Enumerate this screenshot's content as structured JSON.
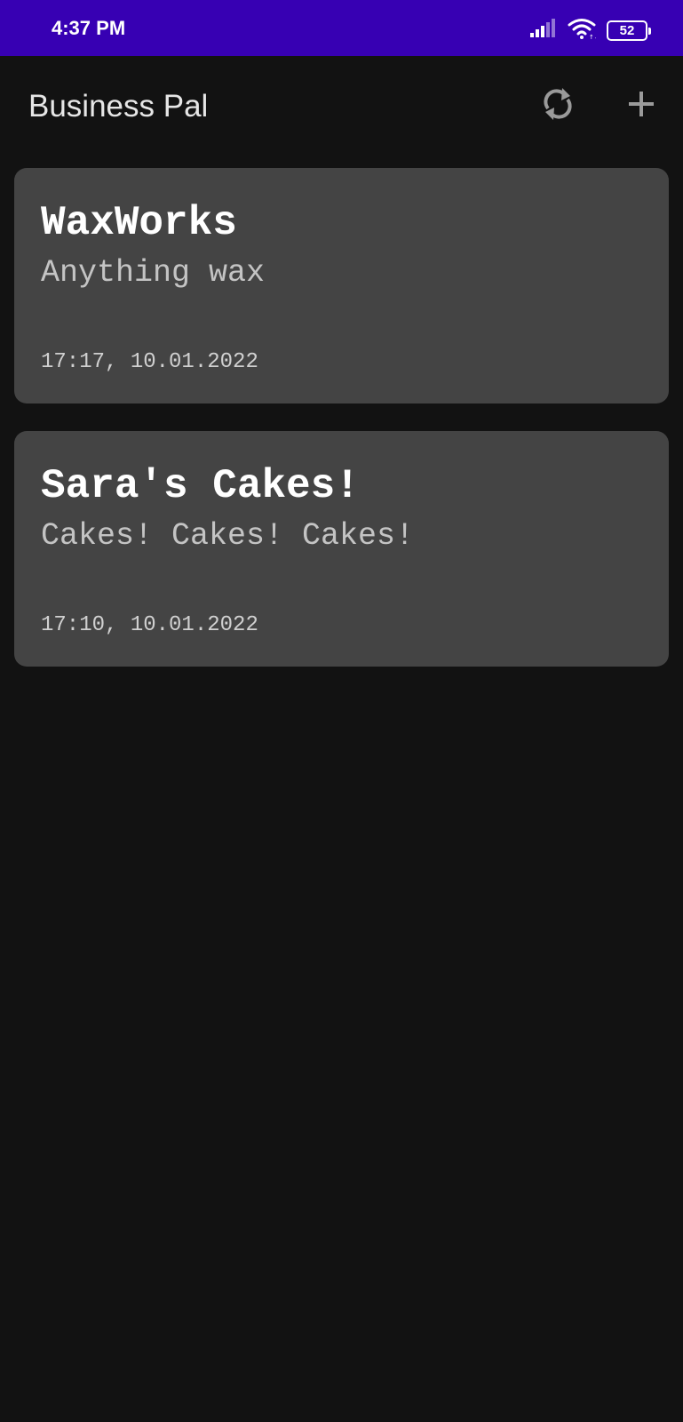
{
  "status_bar": {
    "time": "4:37 PM",
    "battery_level": "52",
    "signal_icon": "signal-bars-icon",
    "wifi_icon": "wifi-icon",
    "background_color": "#3700b3"
  },
  "app_bar": {
    "title": "Business Pal",
    "refresh_icon": "refresh-icon",
    "add_icon": "add-icon"
  },
  "businesses": [
    {
      "name": "WaxWorks",
      "description": "Anything wax",
      "timestamp": "17:17, 10.01.2022"
    },
    {
      "name": "Sara's Cakes!",
      "description": "Cakes! Cakes! Cakes!",
      "timestamp": "17:10, 10.01.2022"
    }
  ],
  "colors": {
    "background": "#121212",
    "card": "#444444",
    "accent": "#3700b3"
  }
}
